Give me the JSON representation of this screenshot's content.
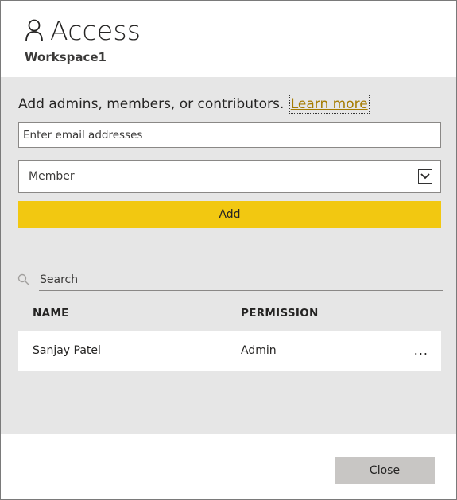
{
  "dialog": {
    "title": "Access",
    "subtitle": "Workspace1"
  },
  "add_section": {
    "instruction": "Add admins, members, or contributors.",
    "learn_more": "Learn more",
    "email_placeholder": "Enter email addresses",
    "role_selected": "Member",
    "add_label": "Add"
  },
  "list": {
    "search_placeholder": "Search",
    "columns": {
      "name": "NAME",
      "permission": "PERMISSION"
    },
    "rows": [
      {
        "name": "Sanjay Patel",
        "permission": "Admin",
        "more": "..."
      }
    ]
  },
  "footer": {
    "close_label": "Close"
  },
  "colors": {
    "accent": "#f2c811",
    "link": "#a67c00",
    "panel": "#e6e6e6"
  },
  "icons": {
    "title": "person-icon",
    "search": "search-icon",
    "dropdown": "chevron-down-icon"
  }
}
